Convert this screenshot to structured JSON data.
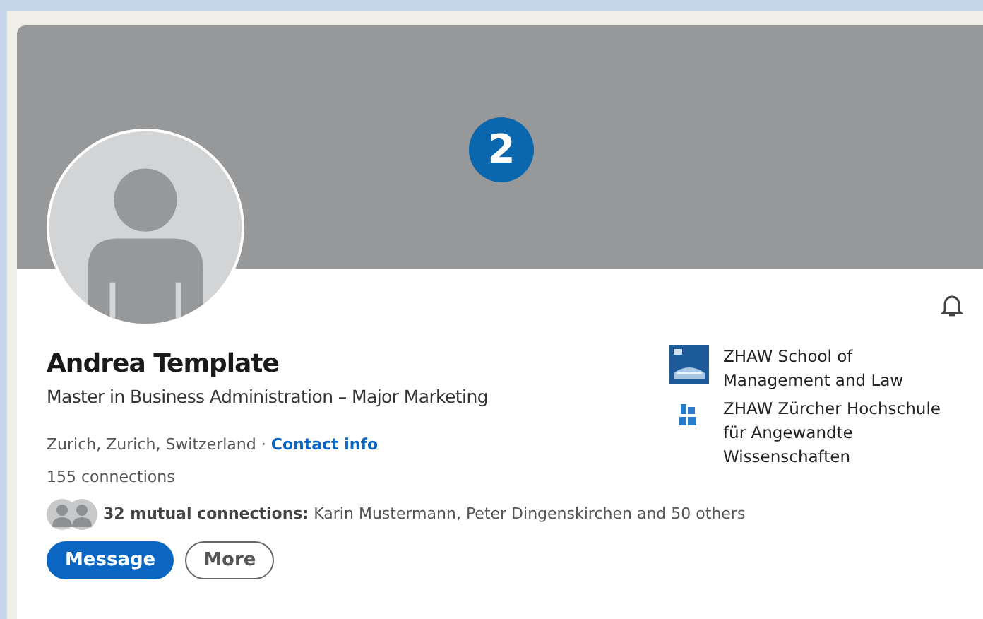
{
  "step_badge": "2",
  "profile": {
    "name": "Andrea Template",
    "headline": "Master in Business Administration – Major Marketing",
    "location": "Zurich, Zurich, Switzerland",
    "separator": "·",
    "contact_link": "Contact info",
    "connections": "155 connections",
    "mutual_label": "32 mutual connections:",
    "mutual_names": "Karin Mustermann, Peter Dingenskirchen and 50 others"
  },
  "buttons": [
    {
      "label": "Message",
      "kind": "primary"
    },
    {
      "label": "More",
      "kind": "outline"
    }
  ],
  "education": [
    {
      "name": "ZHAW School of Management and Law",
      "kind": "building"
    },
    {
      "name": "ZHAW Zürcher Hochschule für Angewandte Wissenschaften",
      "kind": "mark"
    }
  ]
}
